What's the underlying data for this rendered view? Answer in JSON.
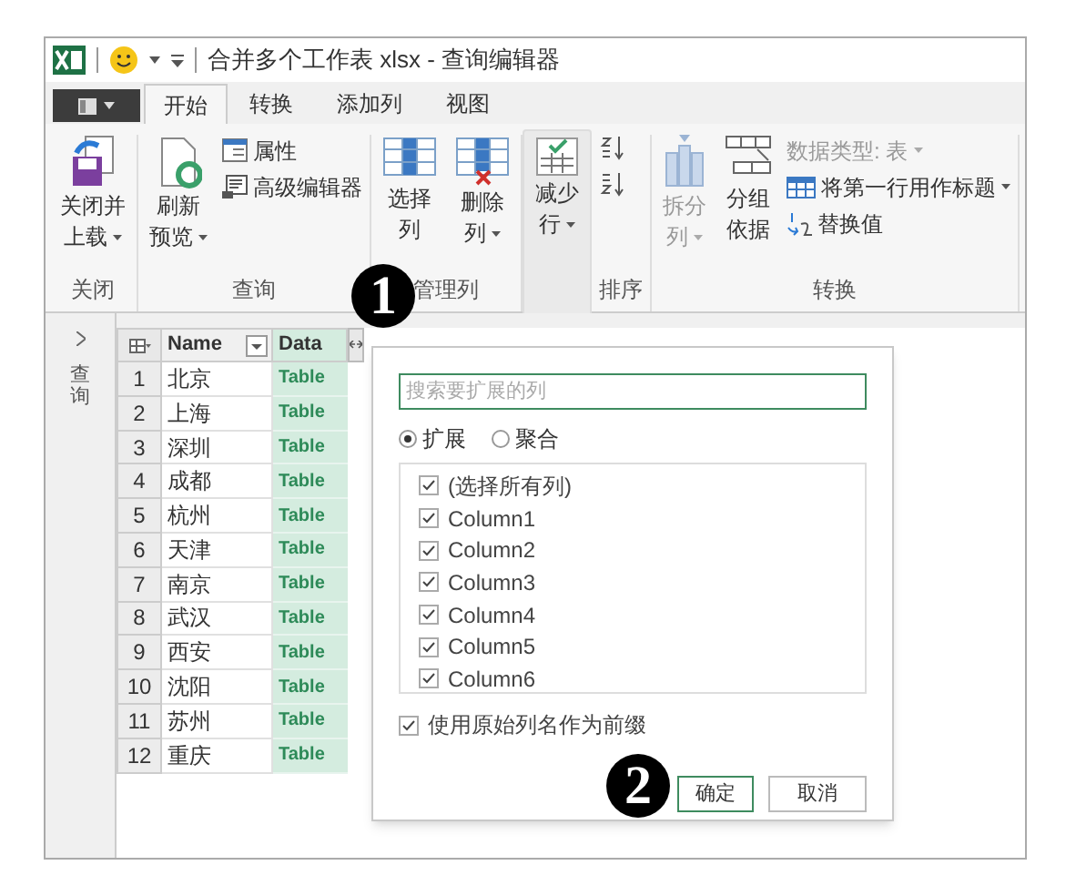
{
  "window": {
    "title": "合并多个工作表 xlsx - 查询编辑器"
  },
  "tabs": [
    {
      "label": "开始",
      "selected": true
    },
    {
      "label": "转换",
      "selected": false
    },
    {
      "label": "添加列",
      "selected": false
    },
    {
      "label": "视图",
      "selected": false
    }
  ],
  "ribbon": {
    "groups": [
      {
        "label": "关闭",
        "buttons": [
          {
            "kind": "large",
            "lines": [
              "关闭并",
              "上载"
            ],
            "dropdown": true,
            "disabled": false
          }
        ]
      },
      {
        "label": "查询",
        "buttons": [
          {
            "kind": "large",
            "lines": [
              "刷新",
              "预览"
            ],
            "dropdown": true,
            "disabled": false
          },
          {
            "kind": "small",
            "lines": [
              "属性"
            ],
            "disabled": false
          },
          {
            "kind": "small",
            "lines": [
              "高级编辑器"
            ],
            "disabled": false
          }
        ]
      },
      {
        "label": "管理列",
        "buttons": [
          {
            "kind": "large",
            "lines": [
              "选择",
              "列"
            ],
            "disabled": false
          },
          {
            "kind": "large",
            "lines": [
              "删除",
              "列"
            ],
            "dropdown": true,
            "disabled": false
          }
        ]
      },
      {
        "buttons": [
          {
            "kind": "large",
            "lines": [
              "减少",
              "行"
            ],
            "dropdown": true,
            "disabled": false
          }
        ]
      },
      {
        "label": "排序",
        "buttons": [
          {
            "kind": "sort",
            "disabled": false
          },
          {
            "kind": "sort",
            "disabled": false
          }
        ]
      },
      {
        "label": "转换",
        "buttons": [
          {
            "kind": "large",
            "lines": [
              "拆分",
              "列"
            ],
            "dropdown": true,
            "disabled": true
          },
          {
            "kind": "large",
            "lines": [
              "分组",
              "依据"
            ],
            "disabled": false
          },
          {
            "kind": "small",
            "lines": [
              "数据类型: 表"
            ],
            "dropdown": true,
            "disabled": true
          },
          {
            "kind": "small",
            "lines": [
              "将第一行用作标题"
            ],
            "dropdown": true,
            "disabled": false
          },
          {
            "kind": "small",
            "lines": [
              "替换值"
            ],
            "disabled": false
          }
        ]
      }
    ]
  },
  "navigator": {
    "label": "查询",
    "expanded": false
  },
  "table": {
    "columns": [
      {
        "label": "Name",
        "selected": false
      },
      {
        "label": "Data",
        "selected": true
      }
    ],
    "rows": [
      {
        "number": "1",
        "name": "北京",
        "data": "Table"
      },
      {
        "number": "2",
        "name": "上海",
        "data": "Table"
      },
      {
        "number": "3",
        "name": "深圳",
        "data": "Table"
      },
      {
        "number": "4",
        "name": "成都",
        "data": "Table"
      },
      {
        "number": "5",
        "name": "杭州",
        "data": "Table"
      },
      {
        "number": "6",
        "name": "天津",
        "data": "Table"
      },
      {
        "number": "7",
        "name": "南京",
        "data": "Table"
      },
      {
        "number": "8",
        "name": "武汉",
        "data": "Table"
      },
      {
        "number": "9",
        "name": "西安",
        "data": "Table"
      },
      {
        "number": "10",
        "name": "沈阳",
        "data": "Table"
      },
      {
        "number": "11",
        "name": "苏州",
        "data": "Table"
      },
      {
        "number": "12",
        "name": "重庆",
        "data": "Table"
      }
    ]
  },
  "expand_dialog": {
    "search": {
      "placeholder": "搜索要扩展的列"
    },
    "modes": [
      {
        "label": "扩展",
        "selected": true
      },
      {
        "label": "聚合",
        "selected": false
      }
    ],
    "columns": [
      {
        "label": "(选择所有列)",
        "checked": true
      },
      {
        "label": "Column1",
        "checked": true
      },
      {
        "label": "Column2",
        "checked": true
      },
      {
        "label": "Column3",
        "checked": true
      },
      {
        "label": "Column4",
        "checked": true
      },
      {
        "label": "Column5",
        "checked": true
      },
      {
        "label": "Column6",
        "checked": true
      }
    ],
    "prefix": {
      "label": "使用原始列名作为前缀",
      "checked": true
    },
    "buttons": [
      {
        "label": "确定",
        "kind": "primary"
      },
      {
        "label": "取消",
        "kind": "secondary"
      }
    ]
  },
  "callouts": [
    "1",
    "2"
  ]
}
